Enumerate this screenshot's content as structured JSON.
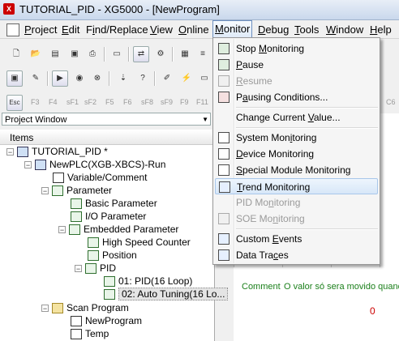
{
  "window": {
    "title": "TUTORIAL_PID - XG5000 - [NewProgram]",
    "app_icon": "xg5000-app-icon"
  },
  "menubar": {
    "items": [
      {
        "label": "Project",
        "u": "P",
        "rest": "roject"
      },
      {
        "label": "Edit",
        "u": "E",
        "rest": "dit"
      },
      {
        "label": "Find/Replace",
        "pre": "F",
        "u": "i",
        "rest": "nd/Replace"
      },
      {
        "label": "View",
        "u": "V",
        "rest": "iew"
      },
      {
        "label": "Online",
        "u": "O",
        "rest": "nline"
      },
      {
        "label": "Monitor",
        "u": "M",
        "rest": "onitor"
      },
      {
        "label": "Debug",
        "u": "D",
        "rest": "ebug"
      },
      {
        "label": "Tools",
        "u": "T",
        "rest": "ools"
      },
      {
        "label": "Window",
        "u": "W",
        "rest": "indow"
      },
      {
        "label": "Help",
        "u": "H",
        "rest": "elp"
      }
    ]
  },
  "fkeys": [
    "Esc",
    "F3",
    "F4",
    "sF1",
    "sF2",
    "F5",
    "F6",
    "sF8",
    "sF9",
    "F9",
    "F11"
  ],
  "fkeys_right": [
    "C6"
  ],
  "project_window": {
    "combo_label": "Project Window",
    "header": "Items",
    "tree": [
      {
        "label": "TUTORIAL_PID *",
        "exp": "−"
      },
      {
        "label": "NewPLC(XGB-XBCS)-Run",
        "exp": "−"
      },
      {
        "label": "Variable/Comment",
        "exp": ""
      },
      {
        "label": "Parameter",
        "exp": "−"
      },
      {
        "label": "Basic Parameter",
        "exp": ""
      },
      {
        "label": "I/O Parameter",
        "exp": ""
      },
      {
        "label": "Embedded Parameter",
        "exp": "−"
      },
      {
        "label": "High Speed Counter",
        "exp": ""
      },
      {
        "label": "Position",
        "exp": ""
      },
      {
        "label": "PID",
        "exp": "−"
      },
      {
        "label": "01: PID(16 Loop)",
        "exp": ""
      },
      {
        "label": "02: Auto Tuning(16 Lo...",
        "exp": ""
      },
      {
        "label": "Scan Program",
        "exp": "−"
      },
      {
        "label": "NewProgram",
        "exp": ""
      },
      {
        "label": "Temp",
        "exp": ""
      }
    ]
  },
  "editor": {
    "comment_label": "Comment",
    "comment_text": "O valor só sera movido quand",
    "value": "0"
  },
  "monitor_menu": {
    "items": [
      {
        "label": "Stop Monitoring",
        "pre": "Stop ",
        "u": "M",
        "rest": "onitoring",
        "icon": "stop-monitoring-icon",
        "enabled": true
      },
      {
        "label": "Pause",
        "pre": "",
        "u": "P",
        "rest": "ause",
        "icon": "pause-icon",
        "enabled": true
      },
      {
        "label": "Resume",
        "pre": "",
        "u": "R",
        "rest": "esume",
        "icon": "resume-icon",
        "enabled": false
      },
      {
        "label": "Pausing Conditions...",
        "pre": "P",
        "u": "a",
        "rest": "using Conditions...",
        "icon": "pausing-conditions-icon",
        "enabled": true
      },
      {
        "label": "Change Current Value...",
        "pre": "Change Current ",
        "u": "V",
        "rest": "alue...",
        "icon": "",
        "enabled": true
      },
      {
        "label": "System Monitoring",
        "pre": "System Mon",
        "u": "i",
        "rest": "toring",
        "icon": "system-monitoring-icon",
        "enabled": true
      },
      {
        "label": "Device Monitoring",
        "pre": "",
        "u": "D",
        "rest": "evice Monitoring",
        "icon": "device-monitoring-icon",
        "enabled": true
      },
      {
        "label": "Special Module Monitoring",
        "pre": "",
        "u": "S",
        "rest": "pecial Module Monitoring",
        "icon": "special-module-icon",
        "enabled": true
      },
      {
        "label": "Trend Monitoring",
        "pre": "",
        "u": "T",
        "rest": "rend Monitoring",
        "icon": "trend-monitoring-icon",
        "enabled": true,
        "highlighted": true
      },
      {
        "label": "PID Monitoring",
        "pre": "PID Mo",
        "u": "n",
        "rest": "itoring",
        "icon": "",
        "enabled": false
      },
      {
        "label": "SOE Monitoring",
        "pre": "SOE Mo",
        "u": "n",
        "rest": "itoring",
        "icon": "soe-monitoring-icon",
        "enabled": false
      },
      {
        "label": "Custom Events",
        "pre": "Custom ",
        "u": "E",
        "rest": "vents",
        "icon": "custom-events-icon",
        "enabled": true
      },
      {
        "label": "Data Traces",
        "pre": "Data Tra",
        "u": "c",
        "rest": "es",
        "icon": "data-traces-icon",
        "enabled": true
      }
    ]
  },
  "colors": {
    "menu_highlight": "#d7e7f8",
    "comment_green": "#1a7f1a",
    "value_red": "#cc0000"
  }
}
